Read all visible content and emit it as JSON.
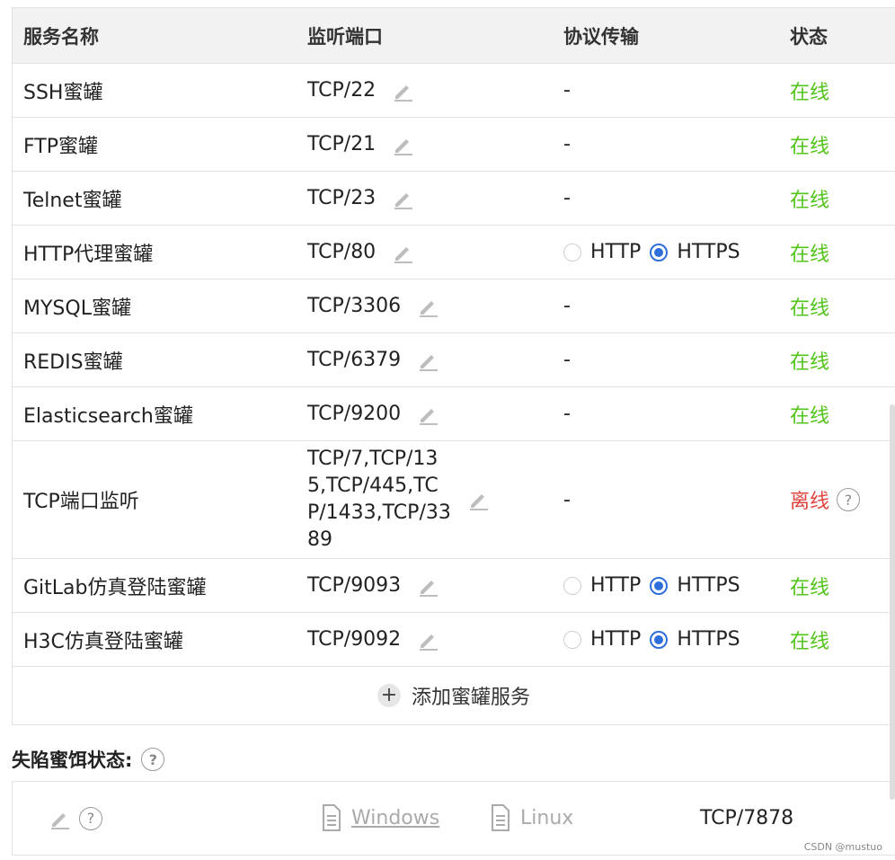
{
  "table": {
    "headers": [
      "服务名称",
      "监听端口",
      "协议传输",
      "状态"
    ],
    "rows": [
      {
        "name": "SSH蜜罐",
        "port": "TCP/22",
        "protocol": "-",
        "status": "在线"
      },
      {
        "name": "FTP蜜罐",
        "port": "TCP/21",
        "protocol": "-",
        "status": "在线"
      },
      {
        "name": "Telnet蜜罐",
        "port": "TCP/23",
        "protocol": "-",
        "status": "在线"
      },
      {
        "name": "HTTP代理蜜罐",
        "port": "TCP/80",
        "protocol": "radio",
        "status": "在线"
      },
      {
        "name": "MYSQL蜜罐",
        "port": "TCP/3306",
        "protocol": "-",
        "status": "在线"
      },
      {
        "name": "REDIS蜜罐",
        "port": "TCP/6379",
        "protocol": "-",
        "status": "在线"
      },
      {
        "name": "Elasticsearch蜜罐",
        "port": "TCP/9200",
        "protocol": "-",
        "status": "在线"
      },
      {
        "name": "TCP端口监听",
        "port": "TCP/7,TCP/135,TCP/445,TCP/1433,TCP/3389",
        "protocol": "-",
        "status": "离线"
      },
      {
        "name": "GitLab仿真登陆蜜罐",
        "port": "TCP/9093",
        "protocol": "radio",
        "status": "在线"
      },
      {
        "name": "H3C仿真登陆蜜罐",
        "port": "TCP/9092",
        "protocol": "radio",
        "status": "在线"
      }
    ],
    "protocol_options": {
      "http": "HTTP",
      "https": "HTTPS",
      "selected": "HTTPS"
    },
    "add_label": "添加蜜罐服务"
  },
  "bait": {
    "title": "失陷蜜饵状态:",
    "windows_label": "Windows",
    "linux_label": "Linux",
    "port": "TCP/7878"
  },
  "watermark": "CSDN @mustuo",
  "colors": {
    "online": "#52c41a",
    "offline": "#e0443e",
    "radio": "#2f6fdc"
  }
}
